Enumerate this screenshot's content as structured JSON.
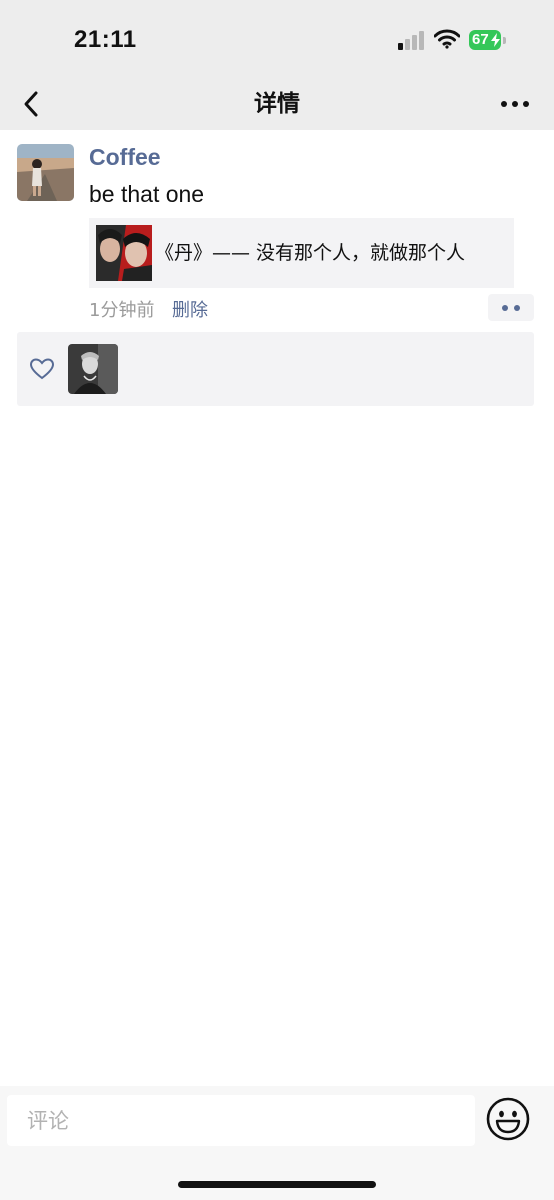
{
  "status_bar": {
    "time": "21:11",
    "battery_percent": "67",
    "battery_color": "#34c759",
    "icons": [
      "signal-icon",
      "wifi-icon",
      "battery-charging-icon"
    ]
  },
  "nav": {
    "title": "详情",
    "back_icon": "chevron-left-icon",
    "more_icon": "more-dots-icon"
  },
  "post": {
    "author": "Coffee",
    "text": "be that one",
    "shared_title": "《丹》—— 没有那个人，就做那个人",
    "time_ago": "1分钟前",
    "delete_label": "删除",
    "link_color": "#576b95",
    "action_icon": "more-dots-icon"
  },
  "likes": {
    "icon": "heart-outline-icon",
    "likers": [
      "liker-avatar"
    ]
  },
  "comment_bar": {
    "placeholder": "评论",
    "emoji_icon": "emoji-smile-icon"
  }
}
